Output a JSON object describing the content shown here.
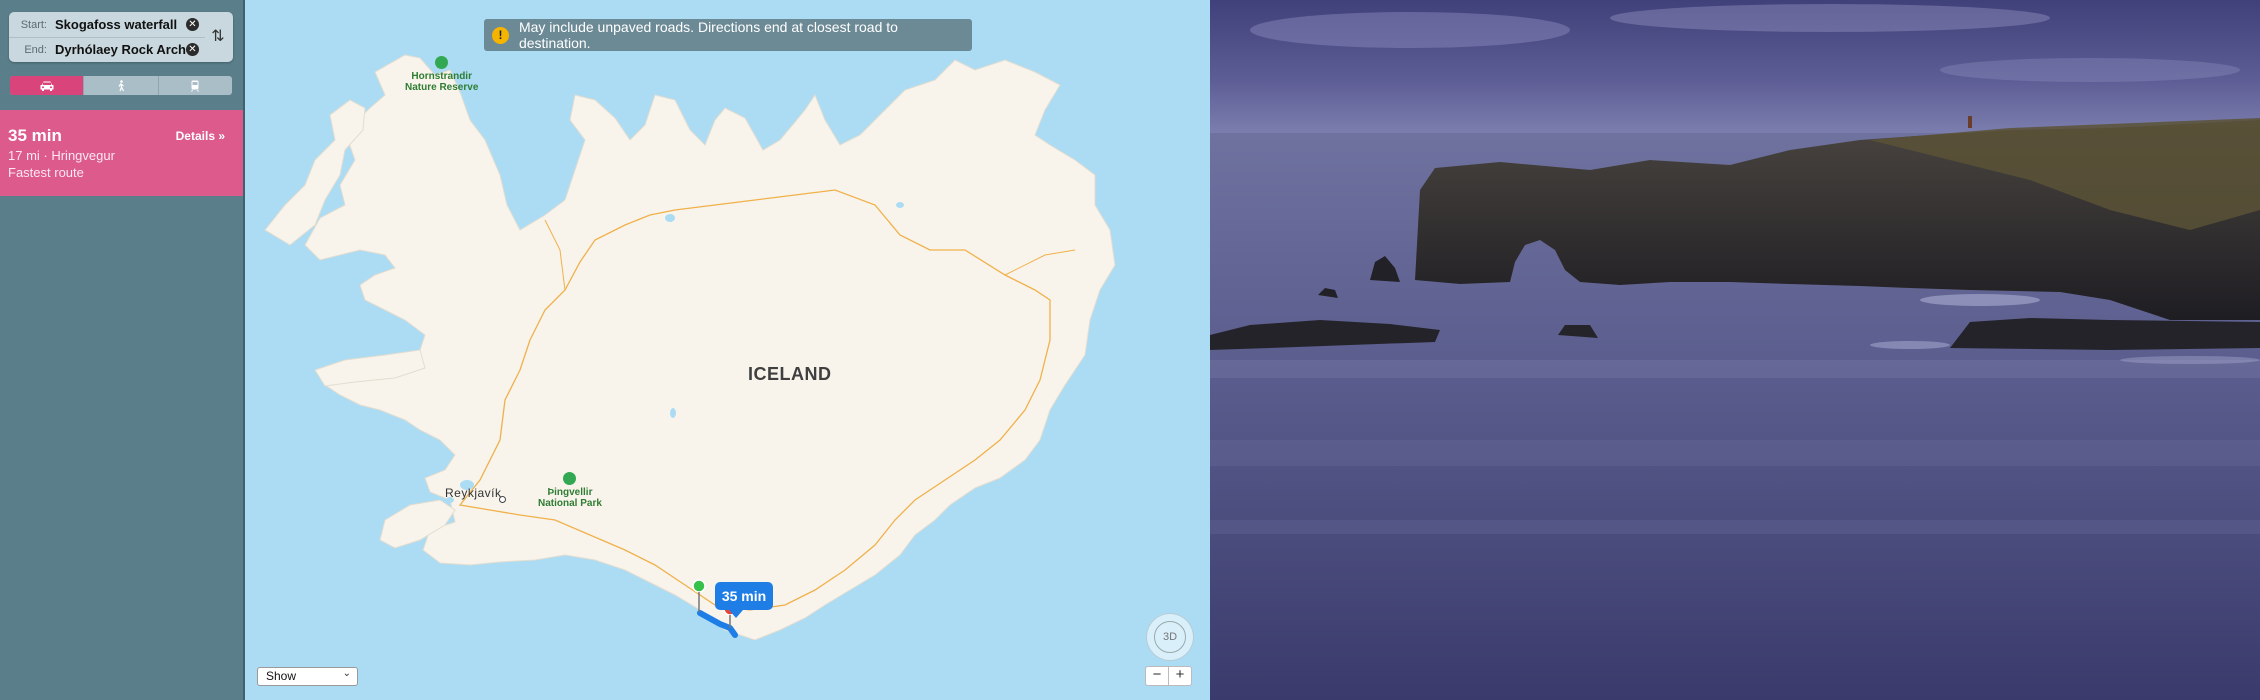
{
  "sidebar": {
    "start_label": "Start:",
    "start_value": "Skogafoss waterfall",
    "end_label": "End:",
    "end_value": "Dyrhólaey Rock Arch",
    "modes": [
      "car",
      "walk",
      "transit"
    ],
    "result": {
      "time": "35 min",
      "details": "Details »",
      "summary": "17 mi · Hringvegur",
      "type": "Fastest route"
    }
  },
  "map": {
    "banner": "May include unpaved roads. Directions end at closest road to destination.",
    "country": "ICELAND",
    "poi_north_line1": "Hornstrandir",
    "poi_north_line2": "Nature Reserve",
    "poi_park_line1": "Þingvellir",
    "poi_park_line2": "National Park",
    "city": "Reykjavík",
    "eta": "35 min",
    "compass": "3D",
    "zoom_out": "−",
    "zoom_in": "+",
    "show_select": "Show"
  },
  "colors": {
    "accent": "#dc5a8c",
    "sidebar_bg": "#5a7f8a",
    "water": "#abdcf4",
    "land": "#f8f4ec",
    "road": "#f0b14a",
    "route": "#1f7ee6"
  }
}
